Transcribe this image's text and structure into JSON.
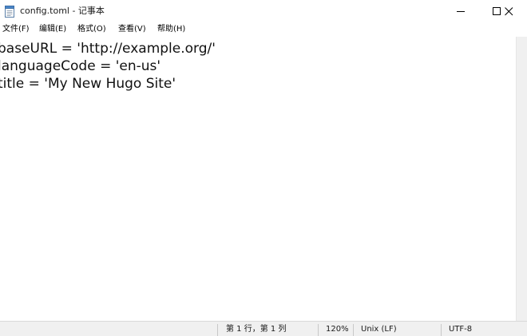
{
  "window": {
    "title": "config.toml - 记事本",
    "icons": {
      "app": "notepad-icon",
      "minimize": "minimize-icon",
      "maximize": "maximize-icon",
      "close": "close-icon"
    }
  },
  "menu": {
    "items": [
      {
        "label": "文件(F)"
      },
      {
        "label": "编辑(E)"
      },
      {
        "label": "格式(O)"
      },
      {
        "label": "查看(V)"
      },
      {
        "label": "帮助(H)"
      }
    ]
  },
  "editor": {
    "lines": [
      "baseURL = 'http://example.org/'",
      "languageCode = 'en-us'",
      "title = 'My New Hugo Site'"
    ]
  },
  "status": {
    "position": "第 1 行，第 1 列",
    "zoom": "120%",
    "line_ending": "Unix (LF)",
    "encoding": "UTF-8"
  }
}
